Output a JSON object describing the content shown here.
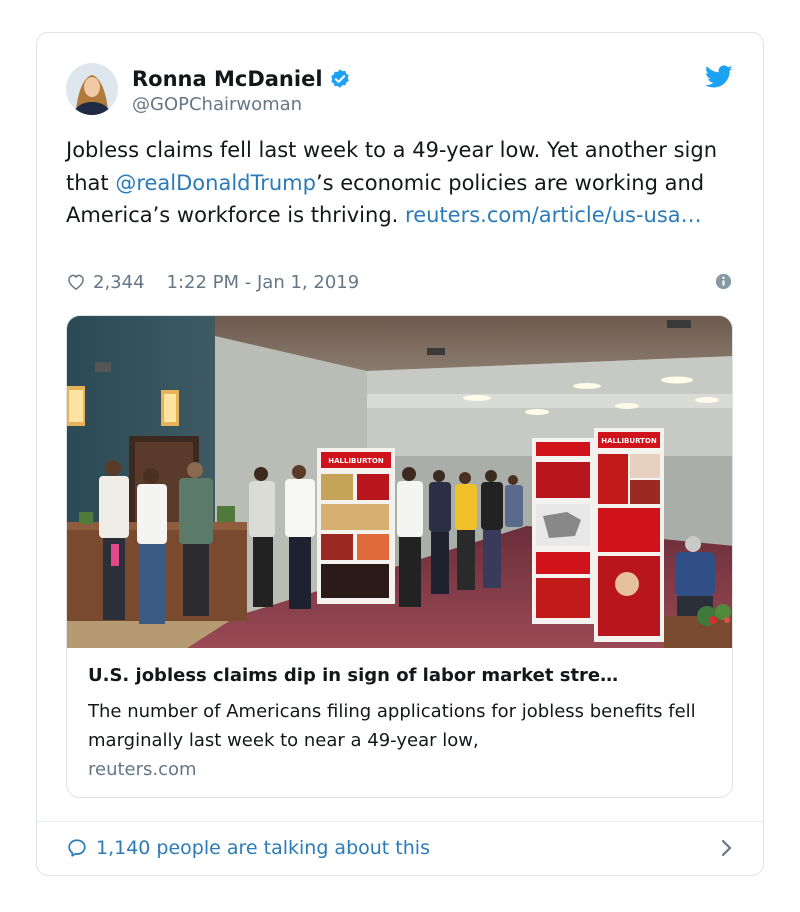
{
  "tweet": {
    "author": {
      "name": "Ronna McDaniel",
      "handle": "@GOPChairwoman"
    },
    "text": {
      "part1": "Jobless claims fell last week to a 49-year low. Yet another sign that ",
      "mention": "@realDonaldTrump",
      "part2": "’s economic policies are working and America’s workforce is thriving. ",
      "link": "reuters.com/article/us-usa…"
    },
    "likes": "2,344",
    "timestamp": "1:22 PM - Jan 1, 2019"
  },
  "link_card": {
    "title": "U.S. jobless claims dip in sign of labor market stre…",
    "description": "The number of Americans filing applications for jobless benefits fell marginally last week to near a 49-year low,",
    "domain": "reuters.com",
    "banner_text": "HALLIBURTON"
  },
  "footer": {
    "label": "1,140 people are talking about this"
  },
  "icons": [
    "verified-badge-icon",
    "twitter-bird-icon",
    "heart-icon",
    "info-icon",
    "speech-bubble-icon",
    "chevron-right-icon"
  ],
  "colors": {
    "link": "#2b7bb9",
    "verified": "#1da1f2",
    "secondary_text": "#657786",
    "banner_red": "#d0121b"
  }
}
